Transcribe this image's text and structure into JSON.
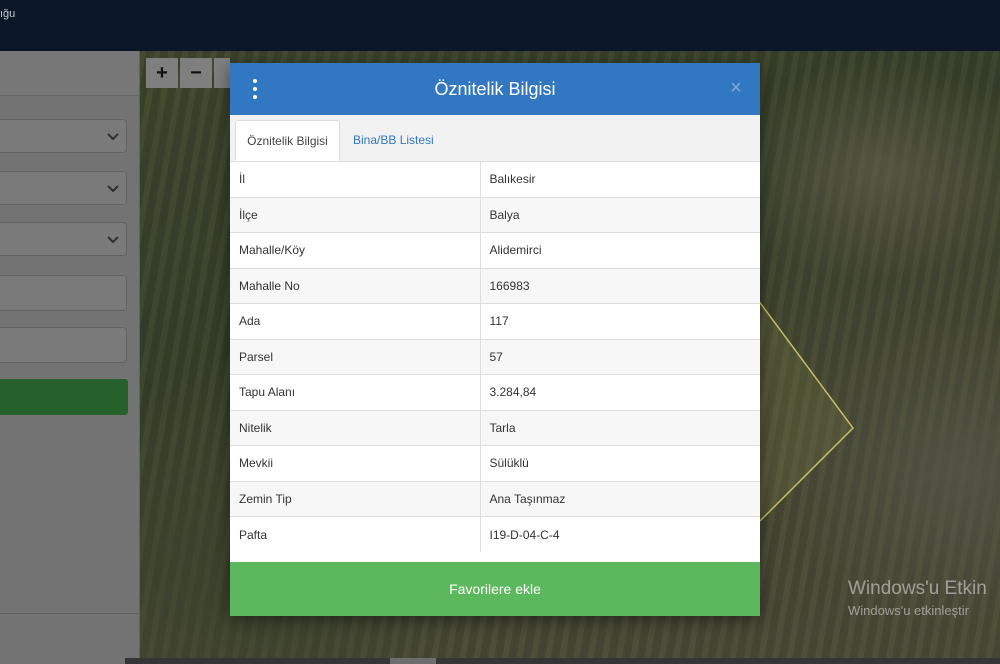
{
  "app": {
    "title_fragment": "ığu"
  },
  "map": {
    "zoom_in_label": "+",
    "zoom_out_label": "−",
    "colors": {
      "parcel_outline": "#d9cf6a"
    }
  },
  "watermark": {
    "line1": "Windows'u Etkin",
    "line2": "Windows'u etkinleştir"
  },
  "modal": {
    "title": "Öznitelik Bilgisi",
    "close_label": "×",
    "tabs": [
      {
        "label": "Öznitelik Bilgisi",
        "active": true
      },
      {
        "label": "Bina/BB Listesi",
        "active": false
      }
    ],
    "rows": [
      {
        "key": "İl",
        "value": "Balıkesir"
      },
      {
        "key": "İlçe",
        "value": "Balya"
      },
      {
        "key": "Mahalle/Köy",
        "value": "Alidemirci"
      },
      {
        "key": "Mahalle No",
        "value": "166983"
      },
      {
        "key": "Ada",
        "value": "117"
      },
      {
        "key": "Parsel",
        "value": "57"
      },
      {
        "key": "Tapu Alanı",
        "value": "3.284,84"
      },
      {
        "key": "Nitelik",
        "value": "Tarla"
      },
      {
        "key": "Mevkii",
        "value": "Sülüklü"
      },
      {
        "key": "Zemin Tip",
        "value": "Ana Taşınmaz"
      },
      {
        "key": "Pafta",
        "value": "I19-D-04-C-4"
      }
    ],
    "favorite_button": "Favorilere ekle",
    "colors": {
      "header": "#3277c2",
      "favorite": "#5cb85c",
      "tab_link": "#3277c2"
    }
  }
}
